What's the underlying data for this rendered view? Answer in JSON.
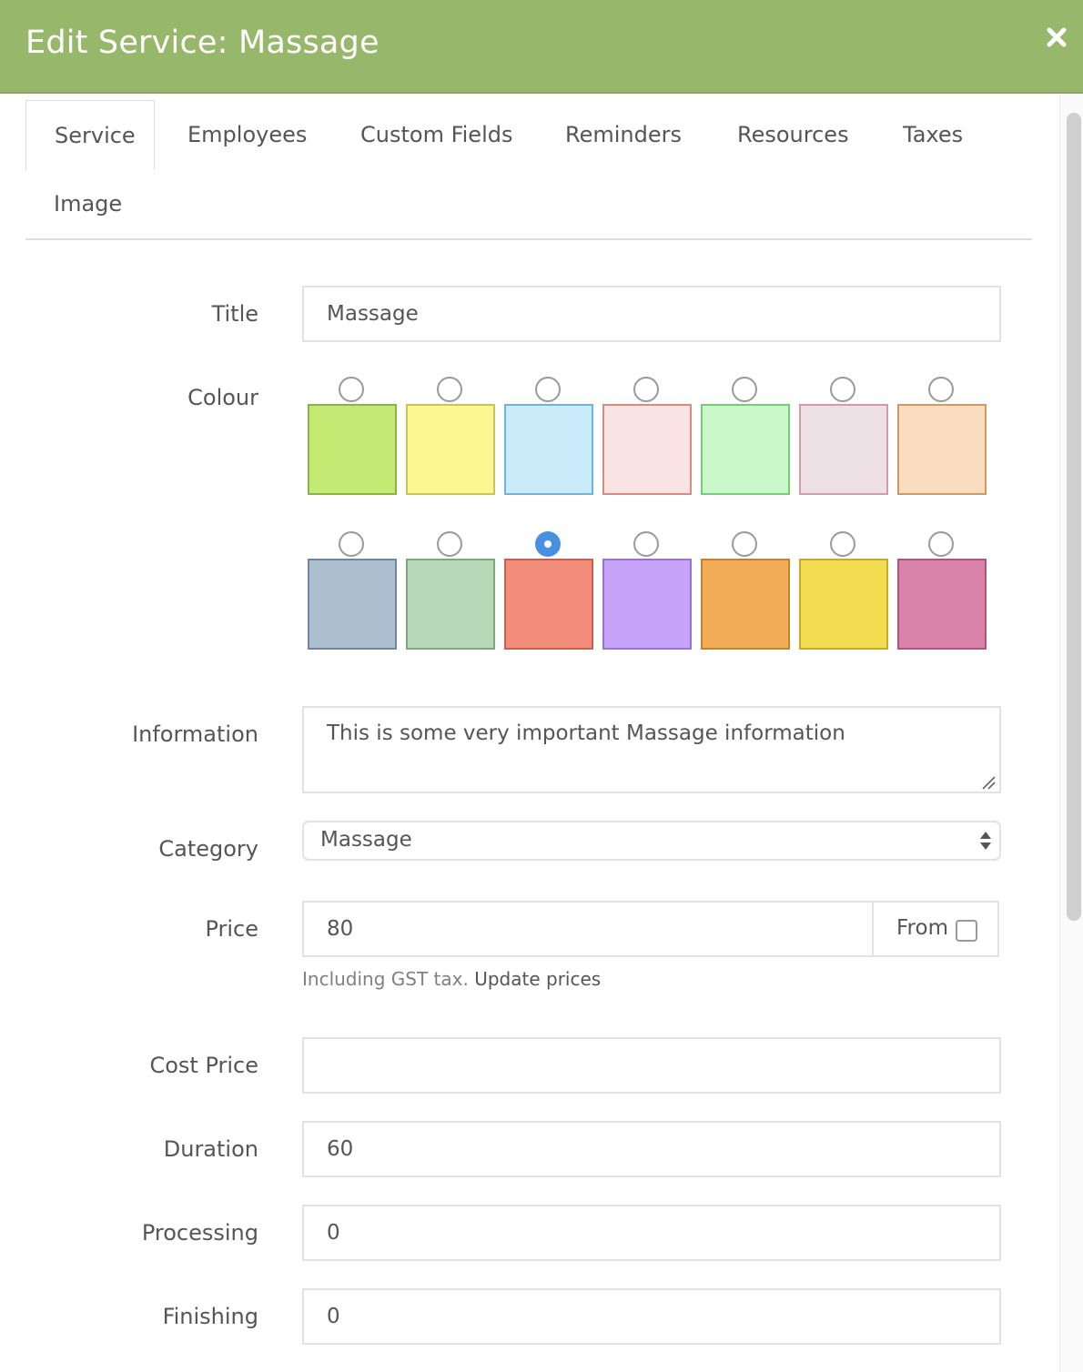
{
  "header": {
    "title": "Edit Service: Massage",
    "close_icon": "close-icon"
  },
  "tabs": [
    {
      "label": "Service",
      "active": true
    },
    {
      "label": "Employees",
      "active": false
    },
    {
      "label": "Custom Fields",
      "active": false
    },
    {
      "label": "Reminders",
      "active": false
    },
    {
      "label": "Resources",
      "active": false
    },
    {
      "label": "Taxes",
      "active": false
    },
    {
      "label": "Image",
      "active": false
    }
  ],
  "form": {
    "title": {
      "label": "Title",
      "value": "Massage"
    },
    "colour": {
      "label": "Colour",
      "selected": "#f28c7b",
      "swatches": [
        {
          "fill": "#c5ea74",
          "border": "#8cb34a"
        },
        {
          "fill": "#fbf791",
          "border": "#c9c35a"
        },
        {
          "fill": "#c9ebfa",
          "border": "#6cb7d9"
        },
        {
          "fill": "#f9e4e3",
          "border": "#d98b82"
        },
        {
          "fill": "#c9f9ca",
          "border": "#74cc77"
        },
        {
          "fill": "#ede0e4",
          "border": "#d49aab"
        },
        {
          "fill": "#fadcbf",
          "border": "#cf9a5f"
        },
        {
          "fill": "#adbece",
          "border": "#7186a0"
        },
        {
          "fill": "#b7d8b7",
          "border": "#7fa87f"
        },
        {
          "fill": "#f28c7b",
          "border": "#c86050"
        },
        {
          "fill": "#c6a3f7",
          "border": "#9a72d4"
        },
        {
          "fill": "#f3ad57",
          "border": "#c7822f"
        },
        {
          "fill": "#f3dc4f",
          "border": "#c2ad2a"
        },
        {
          "fill": "#da82aa",
          "border": "#b05480"
        }
      ]
    },
    "information": {
      "label": "Information",
      "value": "This is some very important Massage information"
    },
    "category": {
      "label": "Category",
      "value": "Massage"
    },
    "price": {
      "label": "Price",
      "value": "80",
      "addon_label": "From",
      "from_checked": false,
      "help_text": "Including GST tax.",
      "help_link": "Update prices"
    },
    "cost_price": {
      "label": "Cost Price",
      "value": ""
    },
    "duration": {
      "label": "Duration",
      "value": "60"
    },
    "processing": {
      "label": "Processing",
      "value": "0"
    },
    "finishing": {
      "label": "Finishing",
      "value": "0"
    }
  }
}
